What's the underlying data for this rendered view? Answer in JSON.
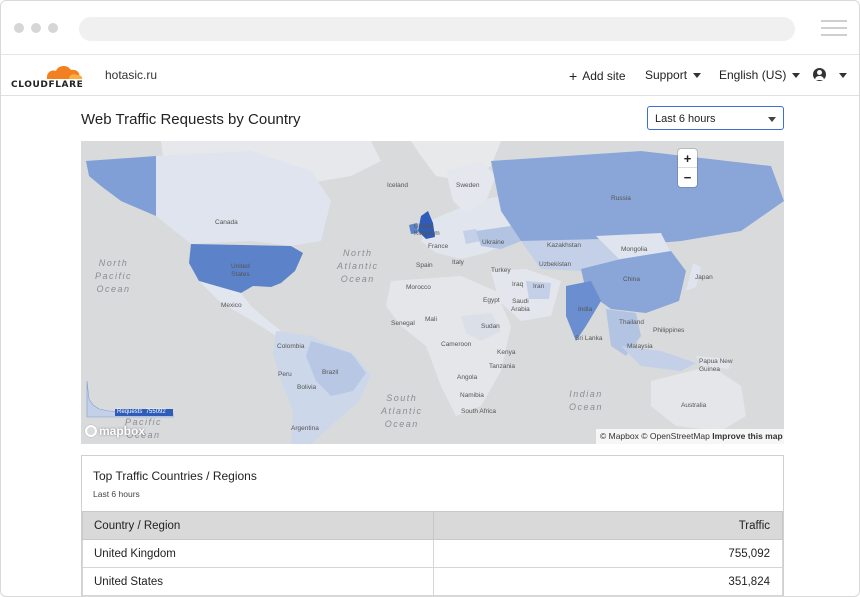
{
  "nav": {
    "site": "hotasic.ru",
    "logo_text": "CLOUDFLARE",
    "add_site": "Add site",
    "support": "Support",
    "language": "English (US)"
  },
  "page": {
    "title": "Web Traffic Requests by Country",
    "time_select": "Last 6 hours"
  },
  "map": {
    "zoom_in": "+",
    "zoom_out": "−",
    "attribution_mapbox": "© Mapbox",
    "attribution_osm": "© OpenStreetMap",
    "improve": "Improve this map",
    "logo": "mapbox",
    "legend_label": "Requests",
    "legend_max": "755092",
    "oceans": {
      "north_pacific": "North\nPacific\nOcean",
      "north_atlantic": "North\nAtlantic\nOcean",
      "south_atlantic": "South\nAtlantic\nOcean",
      "indian": "Indian\nOcean",
      "south_pacific": "Pacific\nOcean"
    },
    "labels": {
      "iceland": "Iceland",
      "sweden": "Sweden",
      "canada": "Canada",
      "russia": "Russia",
      "uk": "United\nKingdom",
      "france": "France",
      "ukraine": "Ukraine",
      "kazakhstan": "Kazakhstan",
      "mongolia": "Mongolia",
      "united_states": "United\nStates",
      "spain": "Spain",
      "italy": "Italy",
      "turkey": "Turkey",
      "uzbekistan": "Uzbekistan",
      "japan": "Japan",
      "china": "China",
      "iraq": "Iraq",
      "iran": "Iran",
      "morocco": "Morocco",
      "egypt": "Egypt",
      "saudi": "Saudi\nArabia",
      "mexico": "Mexico",
      "india": "India",
      "thailand": "Thailand",
      "philippines": "Philippines",
      "mali": "Mali",
      "senegal": "Senegal",
      "sudan": "Sudan",
      "sri_lanka": "Sri Lanka",
      "colombia": "Colombia",
      "cameroon": "Cameroon",
      "kenya": "Kenya",
      "tanzania": "Tanzania",
      "malaysia": "Malaysia",
      "png": "Papua New\nGuinea",
      "peru": "Peru",
      "brazil": "Brazil",
      "angola": "Angola",
      "bolivia": "Bolivia",
      "namibia": "Namibia",
      "australia": "Australia",
      "south_africa": "South Africa",
      "argentina": "Argentina"
    }
  },
  "table": {
    "title": "Top Traffic Countries / Regions",
    "subtitle": "Last 6 hours",
    "col_country": "Country / Region",
    "col_traffic": "Traffic",
    "rows": [
      {
        "country": "United Kingdom",
        "traffic": "755,092"
      },
      {
        "country": "United States",
        "traffic": "351,824"
      }
    ]
  },
  "colors": {
    "uk": "#2e5cb8",
    "us": "#5c83c9",
    "india": "#6a8ed0",
    "russia": "#8aa6d8",
    "brand_orange": "#f38020"
  }
}
